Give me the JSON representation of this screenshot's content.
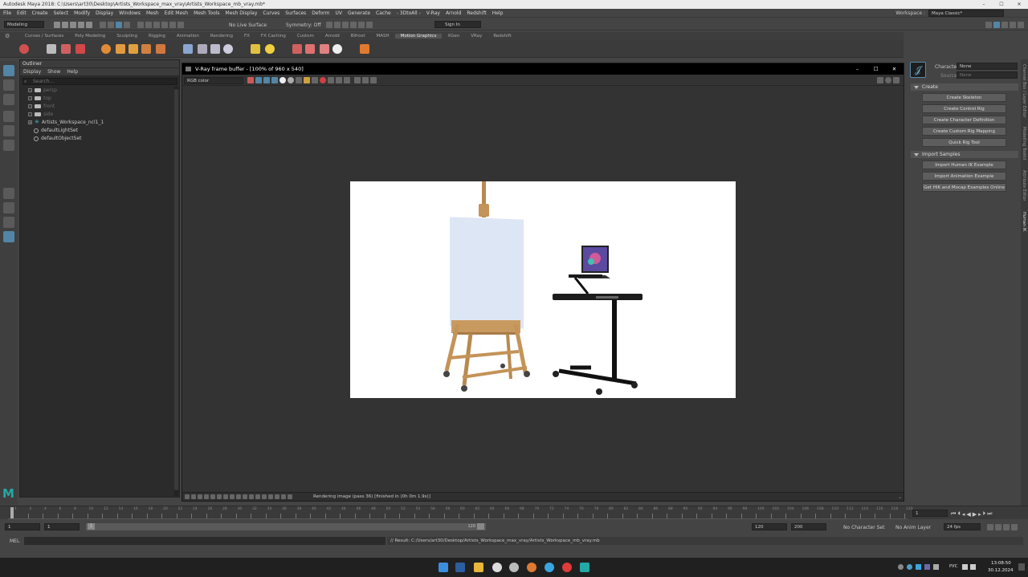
{
  "titlebar": {
    "title": "Autodesk Maya 2018: C:\\Users\\art30\\Desktop\\Artists_Workspace_max_vray\\Artists_Workspace_mb_vray.mb*",
    "min": "–",
    "max": "☐",
    "close": "✕"
  },
  "menus": [
    "File",
    "Edit",
    "Create",
    "Select",
    "Modify",
    "Display",
    "Windows",
    "Mesh",
    "Edit Mesh",
    "Mesh Tools",
    "Mesh Display",
    "Curves",
    "Surfaces",
    "Deform",
    "UV",
    "Generate",
    "Cache",
    "- 3DtoAll -",
    "V-Ray",
    "Arnold",
    "Redshift",
    "Help"
  ],
  "workspace": {
    "label": "Workspace :",
    "value": "Maya Classic*"
  },
  "statusline": {
    "mode": "Modeling",
    "live": "No Live Surface",
    "symmetry": "Symmetry: Off",
    "signin": "Sign In"
  },
  "shelf_tabs": [
    "Curves / Surfaces",
    "Poly Modeling",
    "Sculpting",
    "Rigging",
    "Animation",
    "Rendering",
    "FX",
    "FX Caching",
    "Custom",
    "Arnold",
    "Bifrost",
    "MASH",
    "Motion Graphics",
    "XGen",
    "VRay",
    "Redshift"
  ],
  "shelf_active": "Motion Graphics",
  "outliner": {
    "title": "Outliner",
    "menu": [
      "Display",
      "Show",
      "Help"
    ],
    "search_placeholder": "Search...",
    "items": [
      {
        "label": "persp",
        "kind": "camera",
        "dim": true
      },
      {
        "label": "top",
        "kind": "camera",
        "dim": true
      },
      {
        "label": "front",
        "kind": "camera",
        "dim": true
      },
      {
        "label": "side",
        "kind": "camera",
        "dim": true
      },
      {
        "label": "Artists_Workspace_ncl1_1",
        "kind": "group",
        "dim": false
      },
      {
        "label": "defaultLightSet",
        "kind": "set",
        "dim": false
      },
      {
        "label": "defaultObjectSet",
        "kind": "set",
        "dim": false
      }
    ]
  },
  "vfb": {
    "title": "V-Ray frame buffer - [100% of 960 x 540]",
    "channel": "RGB color",
    "status": "Rendering image (pass 36) [finished in (0h  0m  1.9s)]"
  },
  "character": {
    "character_label": "Character:",
    "character_value": "None",
    "source_label": "Source:",
    "source_value": "None",
    "section_create": "Create",
    "create_buttons": [
      "Create Skeleton",
      "Create Control Rig",
      "Create Character Definition",
      "Create Custom Rig Mapping",
      "Quick Rig Tool"
    ],
    "section_samples": "Import Samples",
    "sample_buttons": [
      "Import Human IK Example",
      "Import Animation Example",
      "Get HIK and Mocap Examples Online"
    ]
  },
  "vtabs": [
    "Channel Box / Layer Editor",
    "Modelling Toolkit",
    "Attribute Editor",
    "Human IK"
  ],
  "timeline": {
    "ticks": [
      "1",
      "2",
      "4",
      "6",
      "8",
      "10",
      "12",
      "14",
      "16",
      "18",
      "20",
      "22",
      "24",
      "26",
      "28",
      "30",
      "32",
      "34",
      "36",
      "38",
      "40",
      "42",
      "44",
      "46",
      "48",
      "50",
      "52",
      "54",
      "56",
      "58",
      "60",
      "62",
      "64",
      "66",
      "68",
      "70",
      "72",
      "74",
      "76",
      "78",
      "80",
      "82",
      "84",
      "86",
      "88",
      "90",
      "92",
      "94",
      "96",
      "98",
      "100",
      "102",
      "104",
      "106",
      "108",
      "110",
      "112",
      "114",
      "116",
      "118",
      "120"
    ],
    "current": "1"
  },
  "range": {
    "start": "1",
    "start2": "1",
    "slider_start": "1",
    "slider_end": "120",
    "end": "120",
    "end2": "200",
    "character": "No Character Set",
    "anim_layer": "No Anim Layer",
    "fps": "24 fps"
  },
  "cmdline": {
    "label": "MEL",
    "result": "// Result: C:/Users/art30/Desktop/Artists_Workspace_max_vray/Artists_Workspace_mb_vray.mb"
  },
  "taskbar": {
    "lang": "РУС",
    "time": "13:08:50",
    "date": "30.12.2024"
  },
  "colors": {
    "accent": "#4b9ecb",
    "maya_logo": "#23a9a6",
    "bg": "#444444"
  }
}
